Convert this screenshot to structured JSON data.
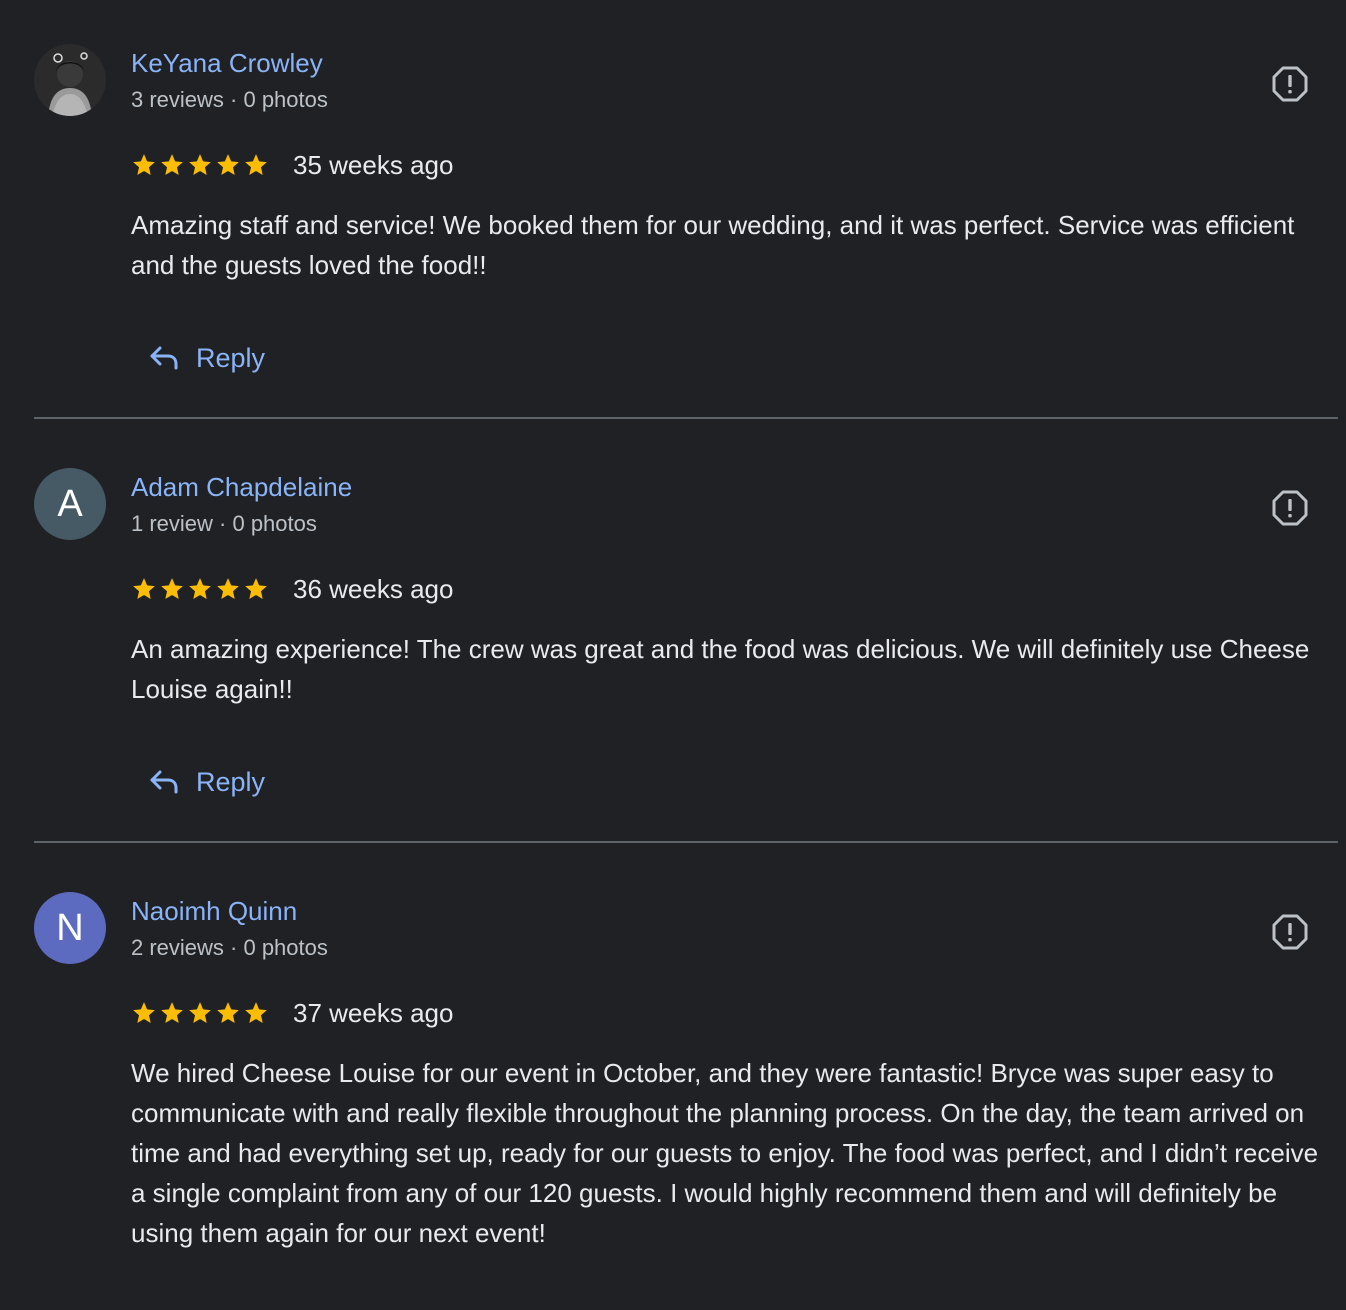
{
  "reviews": [
    {
      "name": "KeYana Crowley",
      "meta": "3 reviews · 0 photos",
      "avatar": {
        "type": "photo",
        "icon": "user-photo",
        "color": "#2a2a2a"
      },
      "rating": 5,
      "time": "35 weeks ago",
      "text": "Amazing staff and service! We booked them for our wedding, and it was perfect. Service was efficient and the guests loved the food!!",
      "reply_label": "Reply"
    },
    {
      "name": "Adam Chapdelaine",
      "meta": "1 review · 0 photos",
      "avatar": {
        "type": "letter",
        "letter": "A",
        "color": "#455a64"
      },
      "rating": 5,
      "time": "36 weeks ago",
      "text": "An amazing experience! The crew was great and the food was delicious. We will definitely use Cheese Louise again!!",
      "reply_label": "Reply"
    },
    {
      "name": "Naoimh Quinn",
      "meta": "2 reviews · 0 photos",
      "avatar": {
        "type": "letter",
        "letter": "N",
        "color": "#5c6bc0"
      },
      "rating": 5,
      "time": "37 weeks ago",
      "text": "We hired Cheese Louise for our event in October, and they were fantastic! Bryce was super easy to communicate with and really flexible throughout the planning process. On the day, the team arrived on time and had everything set up, ready for our guests to enjoy. The food was perfect, and I didn’t receive a single complaint from any of our 120 guests. I would highly recommend them and will definitely be using them again for our next event!",
      "reply_label": null
    }
  ],
  "icons": {
    "flag": "report-icon",
    "reply": "reply-arrow-icon",
    "star": "star-icon"
  },
  "colors": {
    "background": "#202124",
    "link": "#8ab4f8",
    "star": "#fbbc04",
    "divider": "#5f6368"
  }
}
